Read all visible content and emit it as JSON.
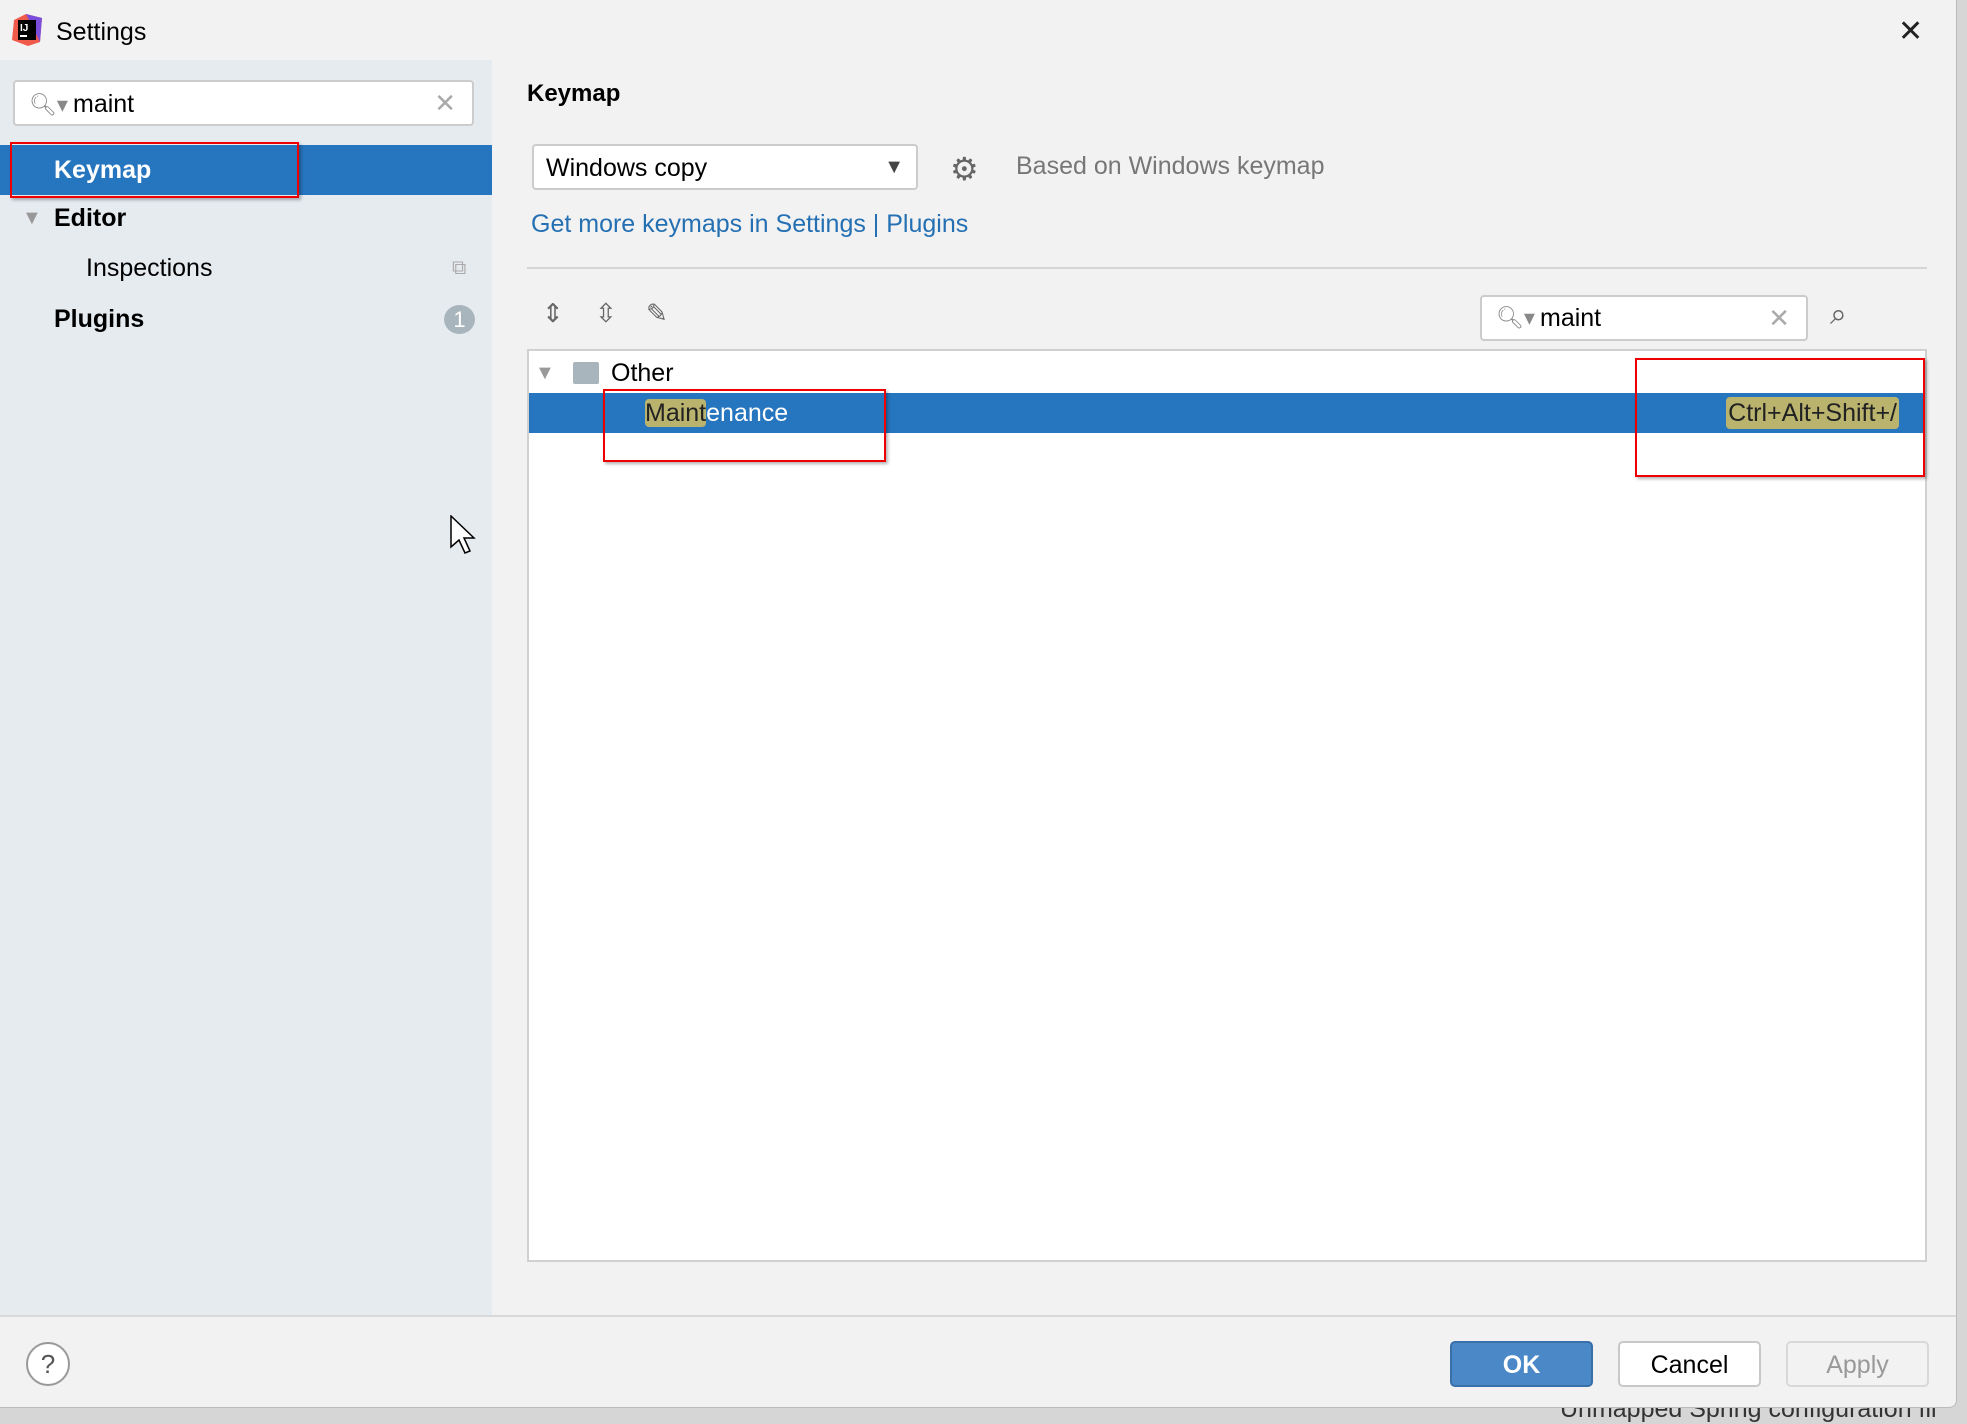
{
  "window": {
    "title": "Settings",
    "close_icon": "close-icon"
  },
  "sidebar": {
    "search": {
      "value": "maint",
      "placeholder": ""
    },
    "items": [
      {
        "label": "Keymap",
        "selected": true
      },
      {
        "label": "Editor",
        "expanded": true
      },
      {
        "label": "Inspections"
      },
      {
        "label": "Plugins",
        "badge": "1"
      }
    ]
  },
  "main": {
    "title": "Keymap",
    "keymap_select": "Windows copy",
    "based_on": "Based on Windows keymap",
    "link": "Get more keymaps in Settings | Plugins",
    "search": {
      "value": "maint"
    },
    "tree": {
      "group": "Other",
      "action": {
        "label_match": "Maint",
        "label_rest": "enance",
        "shortcut": "Ctrl+Alt+Shift+/"
      }
    }
  },
  "footer": {
    "ok": "OK",
    "cancel": "Cancel",
    "apply": "Apply",
    "help": "?"
  },
  "background_text": "Unmapped Spring configuration fil",
  "colors": {
    "selection": "#2675bf",
    "link": "#2470b3",
    "highlight": "#b9b36e",
    "annotation": "#e00000"
  }
}
